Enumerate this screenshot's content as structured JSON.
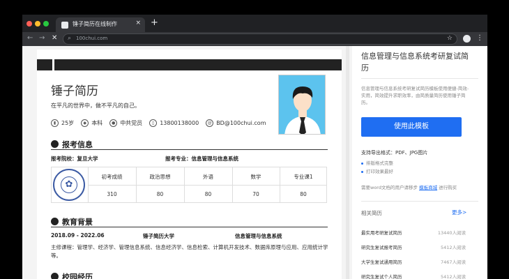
{
  "browser": {
    "tab_title": "锤子简历在线制作",
    "tab_close": "×",
    "new_tab": "+",
    "url": "100chui.com",
    "traffic_colors": [
      "#ff5f57",
      "#febc2e",
      "#28c840"
    ]
  },
  "resume": {
    "name": "锤子简历",
    "tagline": "在平凡的世界中，做不平凡的自己。",
    "info": [
      {
        "icon": "chart-icon",
        "glyph": "▮",
        "text": "25岁"
      },
      {
        "icon": "graduation-icon",
        "glyph": "◆",
        "text": "本科"
      },
      {
        "icon": "badge-icon",
        "glyph": "●",
        "text": "中共党员"
      },
      {
        "icon": "phone-icon",
        "glyph": "▯",
        "text": "13800138000"
      },
      {
        "icon": "mail-icon",
        "glyph": "@",
        "text": "BD@100chui.com"
      }
    ],
    "section_exam": "报考信息",
    "exam_school": "报考院校：复旦大学",
    "exam_major": "报考专业：信息管理与信息系统",
    "grades_headers": [
      "初考成绩",
      "政治思想",
      "外语",
      "数学",
      "专业课1"
    ],
    "grades_values": [
      "310",
      "80",
      "80",
      "70",
      "80"
    ],
    "section_edu": "教育背景",
    "edu_period": "2018.09 - 2022.06",
    "edu_school": "锤子简历大学",
    "edu_major": "信息管理与信息系统",
    "edu_courses": "主修课程：管理学、经济学、管理信息系统、信息经济学、信息检索、计算机开发技术、数据库原理与应用、应用统计学等。",
    "section_campus": "校园经历"
  },
  "sidebar": {
    "title": "信息管理与信息系统考研复试简历",
    "description": "信息管理与信息系统考研复试简历模板使用便捷-简效-实用，简效提升求职效率，由简质量简历使用锤子简历。",
    "use_button": "使用此模板",
    "export_formats": "支持导出格式：PDF、JPG图片",
    "format_items": [
      "排版格式完整",
      "打印效果最好"
    ],
    "helper_prefix": "需要word文档的用户请移步",
    "helper_link": "模板商城",
    "helper_suffix": "进行购买",
    "related_title": "相关简历",
    "related_more": "更多>",
    "related": [
      {
        "name": "最实用考研复试简历",
        "count": "13440人阅读"
      },
      {
        "name": "研究生复试报考简历",
        "count": "5412人阅读"
      },
      {
        "name": "大学生复试通用简历",
        "count": "7467人阅读"
      },
      {
        "name": "研究生复试个人简历",
        "count": "5412人阅读"
      }
    ],
    "accent": "#1f6ef2"
  }
}
